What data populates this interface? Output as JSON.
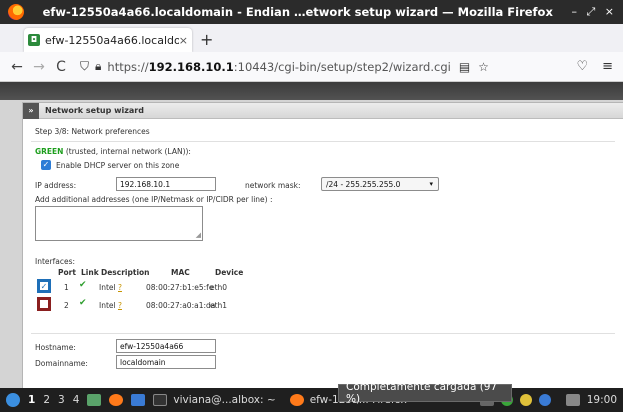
{
  "window": {
    "title": "efw-12550a4a66.localdomain - Endian …etwork setup wizard — Mozilla Firefox",
    "controls": "– ⤢ ×"
  },
  "tabs": [
    {
      "label": "efw-12550a4a66.localdo",
      "close": "×"
    }
  ],
  "newtab": "+",
  "nav": {
    "back": "←",
    "forward": "→",
    "reload": "C",
    "url_prefix": "https://",
    "url_host": "192.168.10.1",
    "url_rest": ":10443/cgi-bin/setup/step2/wizard.cgi"
  },
  "wizard": {
    "header": "Network setup wizard",
    "step": "Step 3/8: Network preferences",
    "zone_name": "GREEN",
    "zone_desc": " (trusted, internal network (LAN)):",
    "dhcp_label": "Enable DHCP server on this zone",
    "ip_label": "IP address:",
    "ip_value": "192.168.10.1",
    "mask_label": "network mask:",
    "mask_value": "/24 - 255.255.255.0",
    "addl_label": "Add additional addresses (one IP/Netmask or IP/CIDR per line) :",
    "interfaces_label": "Interfaces:",
    "columns": [
      "Port",
      "Link",
      "Description",
      "MAC",
      "Device"
    ],
    "rows": [
      {
        "port": "1",
        "desc": "Intel",
        "help": "?",
        "mac": "08:00:27:b1:e5:fe",
        "device": "eth0",
        "checked": true
      },
      {
        "port": "2",
        "desc": "Intel",
        "help": "?",
        "mac": "08:00:27:a0:a1:da",
        "device": "eth1",
        "checked": false
      }
    ],
    "hostname_label": "Hostname:",
    "hostname_value": "efw-12550a4a66",
    "domain_label": "Domainname:",
    "domain_value": "localdomain"
  },
  "taskbar": {
    "workspaces": [
      "1",
      "2",
      "3",
      "4"
    ],
    "task1": "viviana@...albox: ~",
    "task2": "efw-1255... Firefox",
    "clock": "19:00",
    "tooltip": "Completamente cargada (97 %)"
  },
  "colors": {
    "accent": "#2c7cd6",
    "green_zone": "#1d9e1d",
    "taskbar": "#1f1f1f"
  }
}
